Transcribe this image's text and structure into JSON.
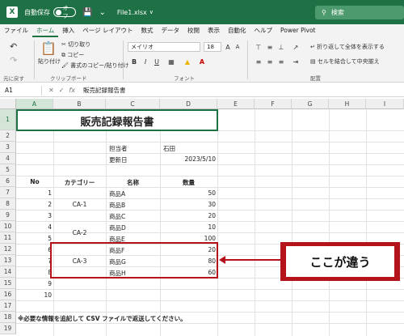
{
  "titlebar": {
    "logo_letter": "X",
    "autosave_label": "自動保存",
    "autosave_state": "オフ",
    "filename": "File1.xlsx",
    "filename_dropdown": "∨",
    "search_placeholder": "検索"
  },
  "menu": [
    "ファイル",
    "ホーム",
    "挿入",
    "ページ レイアウト",
    "数式",
    "データ",
    "校閲",
    "表示",
    "自動化",
    "ヘルプ",
    "Power Pivot"
  ],
  "ribbon": {
    "undo_group": "元に戻す",
    "clipboard_group": "クリップボード",
    "font_group": "フォント",
    "align_group": "配置",
    "paste_label": "貼り付け",
    "cut_label": "切り取り",
    "copy_label": "コピー",
    "format_painter_label": "書式のコピー/貼り付け",
    "font_name": "メイリオ",
    "font_size": "18",
    "wrap_text_label": "折り返して全体を表示する",
    "merge_center_label": "セルを結合して中央揃え"
  },
  "formula_bar": {
    "name_box": "A1",
    "fx": "fx",
    "formula": "販売記録報告書"
  },
  "columns": [
    "A",
    "B",
    "C",
    "D",
    "E",
    "F",
    "G",
    "H",
    "I"
  ],
  "rows": [
    "1",
    "2",
    "3",
    "4",
    "5",
    "6",
    "7",
    "8",
    "9",
    "10",
    "11",
    "12",
    "13",
    "14",
    "15",
    "16",
    "17",
    "18",
    "19"
  ],
  "sheet": {
    "title": "販売記録報告書",
    "person_label": "担当者",
    "person_value": "石田",
    "updated_label": "更新日",
    "updated_value": "2023/5/10",
    "headers": {
      "no": "No",
      "category": "カテゴリー",
      "name": "名称",
      "qty": "数量"
    },
    "categories": [
      "CA-1",
      "CA-2",
      "CA-3"
    ],
    "items": [
      {
        "no": "1",
        "name": "商品A",
        "qty": "50"
      },
      {
        "no": "2",
        "name": "商品B",
        "qty": "30"
      },
      {
        "no": "3",
        "name": "商品C",
        "qty": "20"
      },
      {
        "no": "4",
        "name": "商品D",
        "qty": "10"
      },
      {
        "no": "5",
        "name": "商品E",
        "qty": "100"
      },
      {
        "no": "6",
        "name": "商品F",
        "qty": "20"
      },
      {
        "no": "7",
        "name": "商品G",
        "qty": "80"
      },
      {
        "no": "8",
        "name": "商品H",
        "qty": "60"
      },
      {
        "no": "9",
        "name": "",
        "qty": ""
      },
      {
        "no": "10",
        "name": "",
        "qty": ""
      }
    ],
    "note": "※必要な情報を追記して CSV ファイルで返送してください。"
  },
  "callout_text": "ここが違う",
  "colors": {
    "excel_green": "#1e7145",
    "highlight_red": "#b4131c"
  }
}
